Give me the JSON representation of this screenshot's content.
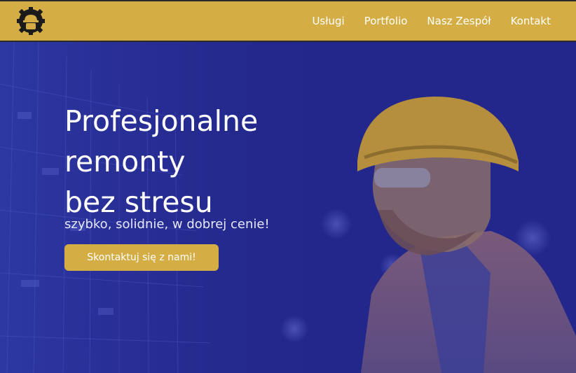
{
  "brand": {
    "logo_icon": "helmet-gear-icon"
  },
  "nav": {
    "items": [
      {
        "label": "Usługi"
      },
      {
        "label": "Portfolio"
      },
      {
        "label": "Nasz Zespół"
      },
      {
        "label": "Kontakt"
      }
    ]
  },
  "hero": {
    "title_lines": [
      "Profesjonalne",
      "remonty",
      "bez stresu"
    ],
    "subtitle": "szybko, solidnie, w dobrej cenie!",
    "cta_label": "Skontaktuj się z nami!",
    "background_icon": "construction-worker-photo"
  },
  "colors": {
    "accent": "#d4ad45",
    "overlay": "#23278b",
    "text": "#ffffff"
  }
}
